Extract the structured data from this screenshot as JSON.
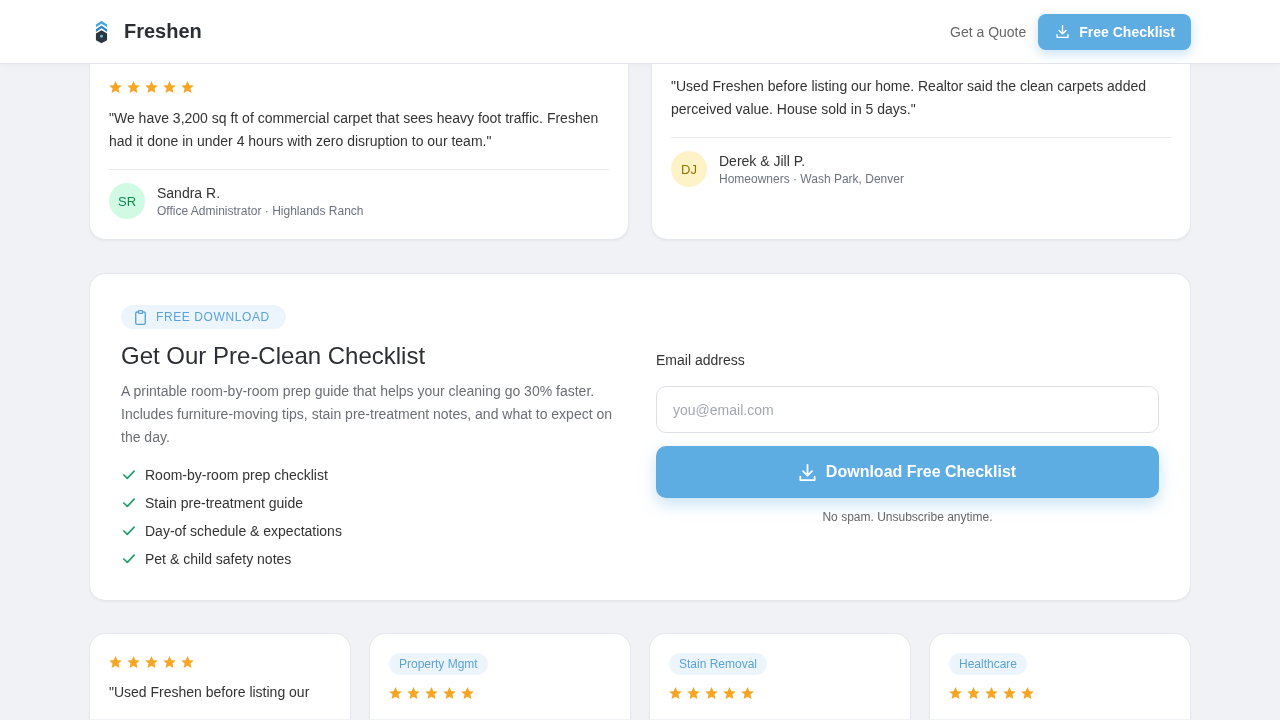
{
  "header": {
    "brand": "Freshen",
    "nav_link": "Get a Quote",
    "cta_button": "Free Checklist"
  },
  "top_testimonials": [
    {
      "stars": 5,
      "quote": "\"We have 3,200 sq ft of commercial carpet that sees heavy foot traffic. Freshen had it done in under 4 hours with zero disruption to our team.\"",
      "author": {
        "initials": "SR",
        "name": "Sandra R.",
        "details": "Office Administrator · Highlands Ranch",
        "color": "#d1fae5"
      }
    },
    {
      "quote": "\"Used Freshen before listing our home. Realtor said the clean carpets added perceived value. House sold in 5 days.\"",
      "author": {
        "initials": "DJ",
        "name": "Derek & Jill P.",
        "details": "Homeowners · Wash Park, Denver",
        "color": "#fef3c7"
      }
    }
  ],
  "lead_magnet": {
    "tag": "FREE DOWNLOAD",
    "title": "Get Our Pre-Clean Checklist",
    "description": "A printable room-by-room prep guide that helps your cleaning go 30% faster. Includes furniture-moving tips, stain pre-treatment notes, and what to expect on the day.",
    "features": [
      "Room-by-room prep checklist",
      "Stain pre-treatment guide",
      "Day-of schedule & expectations",
      "Pet & child safety notes"
    ],
    "form": {
      "label": "Email address",
      "placeholder": "you@email.com",
      "button": "Download Free Checklist",
      "note": "No spam. Unsubscribe anytime."
    }
  },
  "more_testimonials": [
    {
      "stars": 5,
      "quote": "\"Used Freshen before listing our"
    },
    {
      "tag": "Property Mgmt",
      "stars": 5
    },
    {
      "tag": "Stain Removal",
      "stars": 5
    },
    {
      "tag": "Healthcare",
      "stars": 5
    }
  ]
}
